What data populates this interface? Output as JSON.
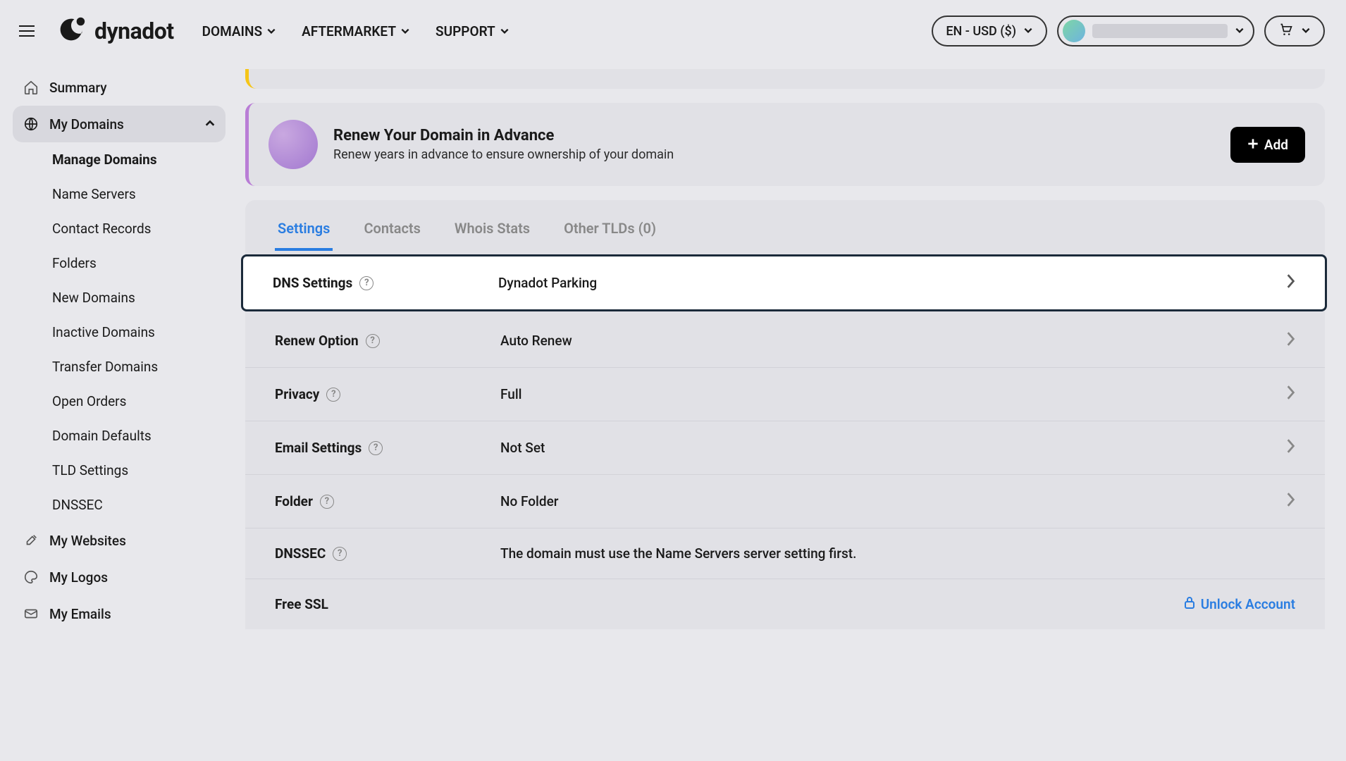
{
  "header": {
    "brand": "dynadot",
    "nav": [
      "DOMAINS",
      "AFTERMARKET",
      "SUPPORT"
    ],
    "locale": "EN - USD ($)"
  },
  "sidebar": {
    "items": [
      {
        "label": "Summary",
        "icon": "home"
      },
      {
        "label": "My Domains",
        "icon": "globe",
        "active": true,
        "expanded": true
      },
      {
        "label": "My Websites",
        "icon": "brush"
      },
      {
        "label": "My Logos",
        "icon": "palette"
      },
      {
        "label": "My Emails",
        "icon": "mail"
      }
    ],
    "sub_items": [
      {
        "label": "Manage Domains",
        "active": true
      },
      {
        "label": "Name Servers"
      },
      {
        "label": "Contact Records"
      },
      {
        "label": "Folders"
      },
      {
        "label": "New Domains"
      },
      {
        "label": "Inactive Domains"
      },
      {
        "label": "Transfer Domains"
      },
      {
        "label": "Open Orders"
      },
      {
        "label": "Domain Defaults"
      },
      {
        "label": "TLD Settings"
      },
      {
        "label": "DNSSEC"
      }
    ]
  },
  "promo": {
    "title": "Renew Your Domain in Advance",
    "subtitle": "Renew years in advance to ensure ownership of your domain",
    "button": "Add"
  },
  "tabs": [
    "Settings",
    "Contacts",
    "Whois Stats",
    "Other TLDs (0)"
  ],
  "settings": [
    {
      "label": "DNS Settings",
      "value": "Dynadot Parking",
      "help": true,
      "chevron": true,
      "highlight": true
    },
    {
      "label": "Renew Option",
      "value": "Auto Renew",
      "help": true,
      "chevron": true
    },
    {
      "label": "Privacy",
      "value": "Full",
      "help": true,
      "chevron": true
    },
    {
      "label": "Email Settings",
      "value": "Not Set",
      "help": true,
      "chevron": true
    },
    {
      "label": "Folder",
      "value": "No Folder",
      "help": true,
      "chevron": true
    },
    {
      "label": "DNSSEC",
      "value": "The domain must use the Name Servers server setting first.",
      "help": true,
      "chevron": false
    },
    {
      "label": "Free SSL",
      "value": "",
      "unlock": "Unlock Account"
    }
  ]
}
